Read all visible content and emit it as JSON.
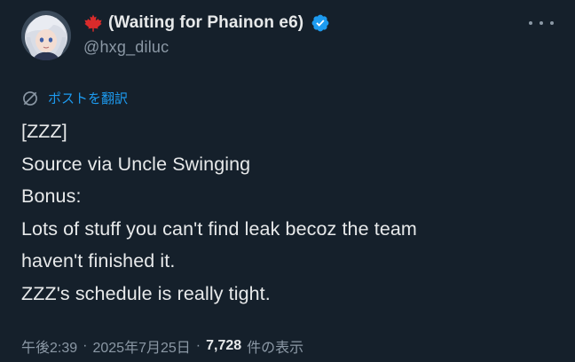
{
  "tweet": {
    "author": {
      "display_name": "(Waiting for Phainon e6)",
      "handle": "@hxg_diluc",
      "avatar_alt": "avatar",
      "flag_icon": "maple-leaf-icon",
      "verified_icon": "verified-badge-icon"
    },
    "more_icon": "more-horizontal-icon",
    "translate": {
      "icon": "globe-translate-icon",
      "label": "ポストを翻訳"
    },
    "body_lines": [
      "[ZZZ]",
      "Source via Uncle Swinging",
      "Bonus:",
      "Lots of stuff you can't find leak becoz the team",
      "haven't finished it.",
      "ZZZ's schedule is really tight."
    ],
    "meta": {
      "time": "午後2:39",
      "date": "2025年7月25日",
      "views_count": "7,728",
      "views_label": "件の表示",
      "separator": "·"
    }
  },
  "colors": {
    "background": "#15202b",
    "text": "#e7e9ea",
    "secondary_text": "#8b98a5",
    "link": "#1d9bf0",
    "maple_red": "#d92b2b",
    "verified_blue": "#1d9bf0"
  }
}
